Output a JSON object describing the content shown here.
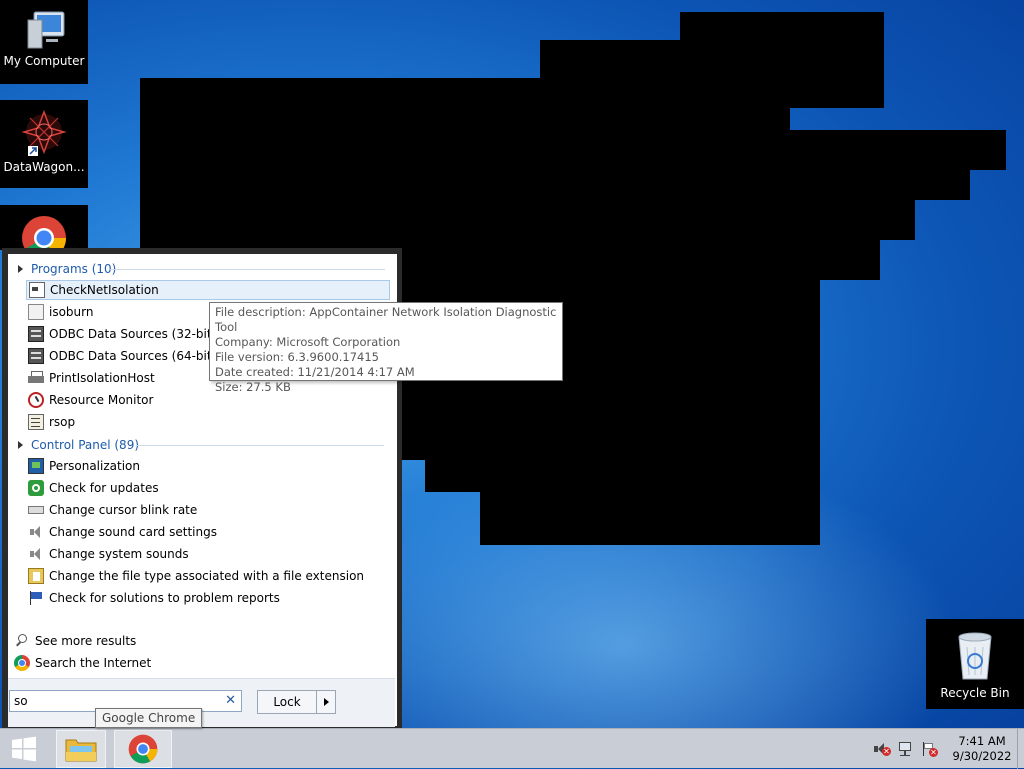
{
  "desktop": {
    "icons": [
      {
        "label": "My Computer",
        "icon": "computer-icon"
      },
      {
        "label": "DataWagon...",
        "icon": "datawagon-shortcut-icon"
      },
      {
        "label": "",
        "icon": "chrome-icon"
      }
    ],
    "recycle_bin": {
      "label": "Recycle Bin",
      "icon": "recycle-bin-icon"
    }
  },
  "start_menu": {
    "programs_header": "Programs (10)",
    "programs": [
      {
        "label": "CheckNetIsolation",
        "icon": "app-window-icon",
        "selected": true
      },
      {
        "label": "isoburn",
        "icon": "app-blank-icon"
      },
      {
        "label": "ODBC Data Sources (32-bit)",
        "icon": "odbc-icon"
      },
      {
        "label": "ODBC Data Sources (64-bit)",
        "icon": "odbc-icon"
      },
      {
        "label": "PrintIsolationHost",
        "icon": "printer-icon"
      },
      {
        "label": "Resource Monitor",
        "icon": "resource-monitor-icon"
      },
      {
        "label": "rsop",
        "icon": "rsop-icon"
      }
    ],
    "control_panel_header": "Control Panel (89)",
    "control_panel": [
      {
        "label": "Personalization",
        "icon": "personalization-icon"
      },
      {
        "label": "Check for updates",
        "icon": "windows-update-icon"
      },
      {
        "label": "Change cursor blink rate",
        "icon": "keyboard-icon"
      },
      {
        "label": "Change sound card settings",
        "icon": "speaker-icon"
      },
      {
        "label": "Change system sounds",
        "icon": "speaker-icon"
      },
      {
        "label": "Change the file type associated with a file extension",
        "icon": "default-programs-icon"
      },
      {
        "label": "Check for solutions to problem reports",
        "icon": "action-center-flag-icon"
      }
    ],
    "see_more": "See more results",
    "search_internet": "Search the Internet",
    "search_value": "so",
    "lock_label": "Lock"
  },
  "tooltip": {
    "description": "File description: AppContainer Network Isolation Diagnostic Tool",
    "company": "Company: Microsoft Corporation",
    "version": "File version: 6.3.9600.17415",
    "created": "Date created: 11/21/2014 4:17 AM",
    "size": "Size: 27.5 KB"
  },
  "chrome_tooltip": "Google Chrome",
  "taskbar": {
    "time": "7:41 AM",
    "date": "9/30/2022"
  },
  "colors": {
    "accent": "#1e5cab",
    "selection": "#e5f0fb"
  }
}
